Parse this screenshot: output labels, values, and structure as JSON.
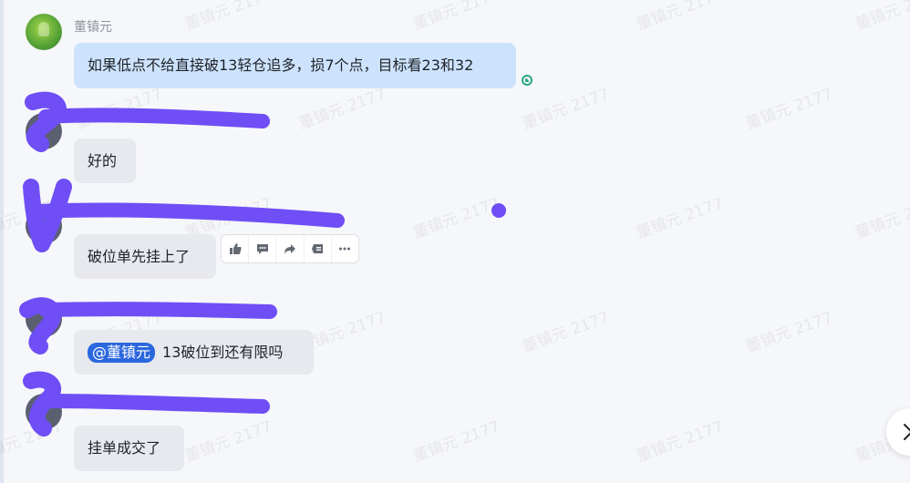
{
  "watermark": "董镇元 2177",
  "messages": [
    {
      "sender": "董镇元",
      "text": "如果低点不给直接破13轻仓追多，损7个点，目标看23和32"
    },
    {
      "text": "好的"
    },
    {
      "text": "破位单先挂上了"
    },
    {
      "mention": "@董镇元",
      "text": "13破位到还有限吗"
    },
    {
      "text": "挂单成交了"
    }
  ],
  "actions": [
    "thumbs-up-icon",
    "comment-icon",
    "forward-icon",
    "quote-icon",
    "more-icon"
  ],
  "colors": {
    "own_bubble": "#cde3fd",
    "other_bubble": "#e7e9ee",
    "mention": "#2b67de",
    "scribble": "#6f4ef6",
    "read": "#2aa87d"
  }
}
